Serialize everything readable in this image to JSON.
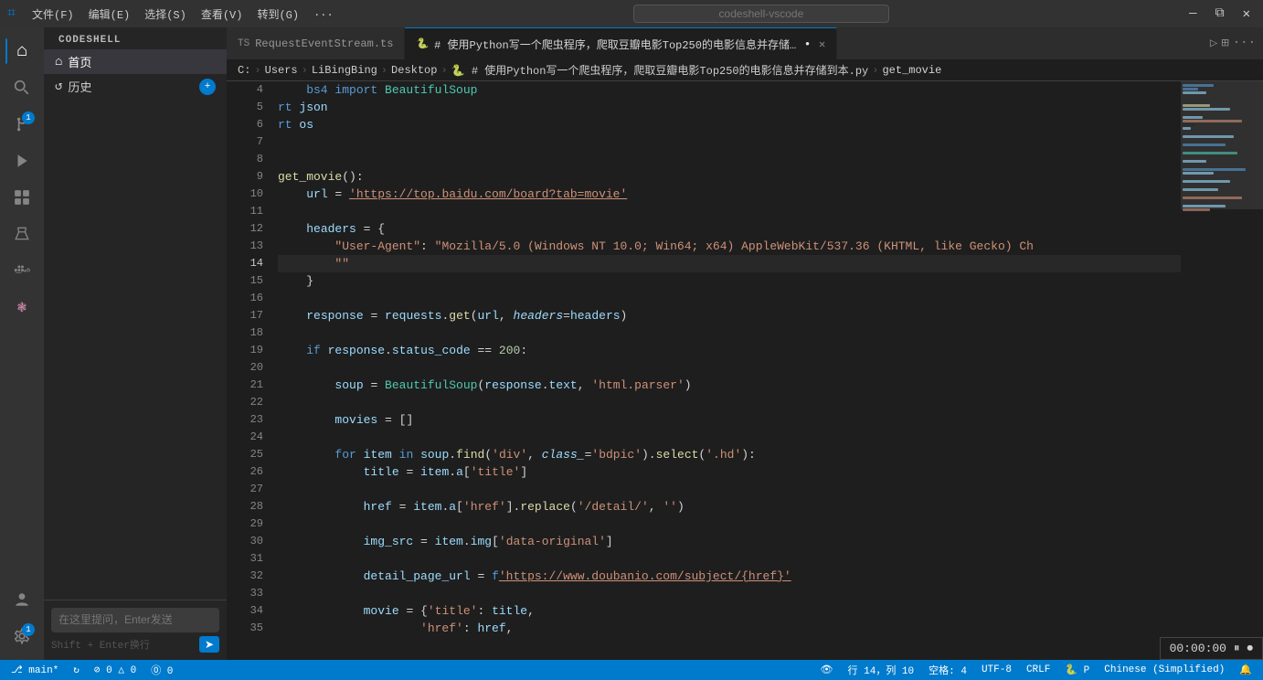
{
  "app": {
    "name": "CODESHELL",
    "title": "codeshell-vscode"
  },
  "titlebar": {
    "menu_items": [
      "文件(F)",
      "编辑(E)",
      "选择(S)",
      "查看(V)",
      "转到(G)",
      "..."
    ],
    "search_placeholder": "codeshell-vscode",
    "win_controls": [
      "—",
      "□",
      "✕"
    ]
  },
  "activitybar": {
    "icons": [
      {
        "id": "home",
        "symbol": "⌂",
        "label": "首页",
        "active": true,
        "badge": null
      },
      {
        "id": "search",
        "symbol": "🔍",
        "label": "搜索",
        "active": false,
        "badge": null
      },
      {
        "id": "git",
        "symbol": "⑂",
        "label": "源代码管理",
        "active": false,
        "badge": "1"
      },
      {
        "id": "debug",
        "symbol": "▷",
        "label": "运行和调试",
        "active": false,
        "badge": null
      },
      {
        "id": "extensions",
        "symbol": "⊞",
        "label": "扩展",
        "active": false,
        "badge": null
      },
      {
        "id": "flask",
        "symbol": "⚗",
        "label": "测试",
        "active": false,
        "badge": null
      },
      {
        "id": "docker",
        "symbol": "🐳",
        "label": "Docker",
        "active": false,
        "badge": null
      },
      {
        "id": "lotus",
        "symbol": "❃",
        "label": "CodeShell",
        "active": false,
        "badge": null
      }
    ],
    "bottom_icons": [
      {
        "id": "account",
        "symbol": "👤",
        "label": "账户",
        "badge": null
      },
      {
        "id": "settings",
        "symbol": "⚙",
        "label": "设置",
        "badge": "1"
      }
    ]
  },
  "sidebar": {
    "header": "CODESHELL",
    "items": [
      {
        "id": "home",
        "icon": "⌂",
        "label": "首页",
        "active": true
      },
      {
        "id": "history",
        "icon": "↺",
        "label": "历史",
        "active": false
      }
    ],
    "new_button": "+",
    "chat_placeholder": "在这里提问，Enter发送",
    "chat_hint": "Shift + Enter换行",
    "chat_send": "➤"
  },
  "tabs": [
    {
      "id": "ts-tab",
      "lang": "TS",
      "name": "RequestEventStream.ts",
      "active": false,
      "modified": false
    },
    {
      "id": "py-tab",
      "lang": "🐍",
      "name": "# 使用Python写一个爬虫程序，爬取豆瓣电影Top250的电影信息并存储到本.py",
      "active": true,
      "modified": true
    }
  ],
  "breadcrumb": [
    "C:",
    "Users",
    "LiBingBing",
    "Desktop",
    "🐍 # 使用Python写一个爬虫程序，爬取豆瓣电影Top250的电影信息并存储到本.py",
    "get_movie"
  ],
  "code": {
    "lines": [
      {
        "num": 4,
        "content": "    bs4 import BeautifulSoup",
        "tokens": [
          {
            "t": "kw",
            "v": "    bs4 import "
          },
          {
            "t": "cls",
            "v": "BeautifulSoup"
          }
        ]
      },
      {
        "num": 5,
        "content": "rt json",
        "tokens": [
          {
            "t": "kw",
            "v": "rt "
          },
          {
            "t": "var",
            "v": "json"
          }
        ]
      },
      {
        "num": 6,
        "content": "rt os",
        "tokens": [
          {
            "t": "kw",
            "v": "rt "
          },
          {
            "t": "var",
            "v": "os"
          }
        ]
      },
      {
        "num": 7,
        "content": "",
        "tokens": []
      },
      {
        "num": 8,
        "content": "",
        "tokens": []
      },
      {
        "num": 9,
        "content": "get_movie():",
        "tokens": [
          {
            "t": "fn",
            "v": "get_movie"
          },
          {
            "t": "punct",
            "v": "():"
          }
        ]
      },
      {
        "num": 10,
        "content": "    url = 'https://top.baidu.com/board?tab=movie'",
        "tokens": [
          {
            "t": "indent",
            "v": "    "
          },
          {
            "t": "var",
            "v": "url"
          },
          {
            "t": "op",
            "v": " = "
          },
          {
            "t": "str-link",
            "v": "'https://top.baidu.com/board?tab=movie'"
          }
        ]
      },
      {
        "num": 11,
        "content": "",
        "tokens": []
      },
      {
        "num": 12,
        "content": "    headers = {",
        "tokens": [
          {
            "t": "indent",
            "v": "    "
          },
          {
            "t": "var",
            "v": "headers"
          },
          {
            "t": "op",
            "v": " = {"
          }
        ]
      },
      {
        "num": 13,
        "content": "        \"User-Agent\": \"Mozilla/5.0 (Windows NT 10.0; Win64; x64) AppleWebKit/537.36 (KHTML, like Gecko) Ch",
        "tokens": [
          {
            "t": "indent",
            "v": "        "
          },
          {
            "t": "str",
            "v": "\"User-Agent\""
          },
          {
            "t": "op",
            "v": ": "
          },
          {
            "t": "str",
            "v": "\"Mozilla/5.0 (Windows NT 10.0; Win64; x64) AppleWebKit/537.36 (KHTML, like Gecko) Ch"
          }
        ]
      },
      {
        "num": 14,
        "content": "        \"\"",
        "tokens": [
          {
            "t": "indent",
            "v": "        "
          },
          {
            "t": "str",
            "v": "\"\""
          }
        ],
        "current": true
      },
      {
        "num": 15,
        "content": "    }",
        "tokens": [
          {
            "t": "indent",
            "v": "    "
          },
          {
            "t": "op",
            "v": "}"
          }
        ]
      },
      {
        "num": 16,
        "content": "",
        "tokens": []
      },
      {
        "num": 17,
        "content": "    response = requests.get(url, headers=headers)",
        "tokens": [
          {
            "t": "indent",
            "v": "    "
          },
          {
            "t": "var",
            "v": "response"
          },
          {
            "t": "op",
            "v": " = "
          },
          {
            "t": "var",
            "v": "requests"
          },
          {
            "t": "op",
            "v": "."
          },
          {
            "t": "fn",
            "v": "get"
          },
          {
            "t": "op",
            "v": "("
          },
          {
            "t": "var",
            "v": "url"
          },
          {
            "t": "op",
            "v": ", "
          },
          {
            "t": "param",
            "v": "headers"
          },
          {
            "t": "op",
            "v": "="
          },
          {
            "t": "var",
            "v": "headers"
          },
          {
            "t": "op",
            "v": ")"
          }
        ]
      },
      {
        "num": 18,
        "content": "",
        "tokens": []
      },
      {
        "num": 19,
        "content": "    if response.status_code == 200:",
        "tokens": [
          {
            "t": "indent",
            "v": "    "
          },
          {
            "t": "kw",
            "v": "if "
          },
          {
            "t": "var",
            "v": "response"
          },
          {
            "t": "op",
            "v": "."
          },
          {
            "t": "var",
            "v": "status_code"
          },
          {
            "t": "op",
            "v": " == "
          },
          {
            "t": "num",
            "v": "200"
          },
          {
            "t": "op",
            "v": ":"
          }
        ]
      },
      {
        "num": 20,
        "content": "",
        "tokens": []
      },
      {
        "num": 21,
        "content": "        soup = BeautifulSoup(response.text, 'html.parser')",
        "tokens": [
          {
            "t": "indent",
            "v": "        "
          },
          {
            "t": "var",
            "v": "soup"
          },
          {
            "t": "op",
            "v": " = "
          },
          {
            "t": "cls",
            "v": "BeautifulSoup"
          },
          {
            "t": "op",
            "v": "("
          },
          {
            "t": "var",
            "v": "response"
          },
          {
            "t": "op",
            "v": "."
          },
          {
            "t": "var",
            "v": "text"
          },
          {
            "t": "op",
            "v": ", "
          },
          {
            "t": "str",
            "v": "'html.parser'"
          },
          {
            "t": "op",
            "v": ")"
          }
        ]
      },
      {
        "num": 22,
        "content": "",
        "tokens": []
      },
      {
        "num": 23,
        "content": "        movies = []",
        "tokens": [
          {
            "t": "indent",
            "v": "        "
          },
          {
            "t": "var",
            "v": "movies"
          },
          {
            "t": "op",
            "v": " = []"
          }
        ]
      },
      {
        "num": 24,
        "content": "",
        "tokens": []
      },
      {
        "num": 25,
        "content": "        for item in soup.find('div', class_='bdpic').select('.hd'):",
        "tokens": [
          {
            "t": "indent",
            "v": "        "
          },
          {
            "t": "kw",
            "v": "for "
          },
          {
            "t": "var",
            "v": "item"
          },
          {
            "t": "kw",
            "v": " in "
          },
          {
            "t": "var",
            "v": "soup"
          },
          {
            "t": "op",
            "v": "."
          },
          {
            "t": "fn",
            "v": "find"
          },
          {
            "t": "op",
            "v": "("
          },
          {
            "t": "str",
            "v": "'div'"
          },
          {
            "t": "op",
            "v": ", "
          },
          {
            "t": "param",
            "v": "class_"
          },
          {
            "t": "op",
            "v": "="
          },
          {
            "t": "str",
            "v": "'bdpic'"
          },
          {
            "t": "op",
            "v": ")."
          },
          {
            "t": "fn",
            "v": "select"
          },
          {
            "t": "op",
            "v": "("
          },
          {
            "t": "str",
            "v": "'.hd'"
          },
          {
            "t": "op",
            "v": "):"
          }
        ]
      },
      {
        "num": 26,
        "content": "            title = item.a['title']",
        "tokens": [
          {
            "t": "indent",
            "v": "            "
          },
          {
            "t": "var",
            "v": "title"
          },
          {
            "t": "op",
            "v": " = "
          },
          {
            "t": "var",
            "v": "item"
          },
          {
            "t": "op",
            "v": "."
          },
          {
            "t": "var",
            "v": "a"
          },
          {
            "t": "op",
            "v": "["
          },
          {
            "t": "str",
            "v": "'title'"
          },
          {
            "t": "op",
            "v": "]"
          }
        ]
      },
      {
        "num": 27,
        "content": "",
        "tokens": []
      },
      {
        "num": 28,
        "content": "            href = item.a['href'].replace('/detail/', '')",
        "tokens": [
          {
            "t": "indent",
            "v": "            "
          },
          {
            "t": "var",
            "v": "href"
          },
          {
            "t": "op",
            "v": " = "
          },
          {
            "t": "var",
            "v": "item"
          },
          {
            "t": "op",
            "v": "."
          },
          {
            "t": "var",
            "v": "a"
          },
          {
            "t": "op",
            "v": "["
          },
          {
            "t": "str",
            "v": "'href'"
          },
          {
            "t": "op",
            "v": "]."
          },
          {
            "t": "fn",
            "v": "replace"
          },
          {
            "t": "op",
            "v": "("
          },
          {
            "t": "str",
            "v": "'/detail/'"
          },
          {
            "t": "op",
            "v": ", "
          },
          {
            "t": "str",
            "v": "''"
          },
          {
            "t": "op",
            "v": ")"
          }
        ]
      },
      {
        "num": 29,
        "content": "",
        "tokens": []
      },
      {
        "num": 30,
        "content": "            img_src = item.img['data-original']",
        "tokens": [
          {
            "t": "indent",
            "v": "            "
          },
          {
            "t": "var",
            "v": "img_src"
          },
          {
            "t": "op",
            "v": " = "
          },
          {
            "t": "var",
            "v": "item"
          },
          {
            "t": "op",
            "v": "."
          },
          {
            "t": "var",
            "v": "img"
          },
          {
            "t": "op",
            "v": "["
          },
          {
            "t": "str",
            "v": "'data-original'"
          },
          {
            "t": "op",
            "v": "]"
          }
        ]
      },
      {
        "num": 31,
        "content": "",
        "tokens": []
      },
      {
        "num": 32,
        "content": "            detail_page_url = f'https://www.doubanio.com/subject/{href}'",
        "tokens": [
          {
            "t": "indent",
            "v": "            "
          },
          {
            "t": "var",
            "v": "detail_page_url"
          },
          {
            "t": "op",
            "v": " = "
          },
          {
            "t": "kw",
            "v": "f"
          },
          {
            "t": "str-link",
            "v": "'https://www.doubanio.com/subject/{href}'"
          }
        ]
      },
      {
        "num": 33,
        "content": "",
        "tokens": []
      },
      {
        "num": 34,
        "content": "            movie = {'title': title,",
        "tokens": [
          {
            "t": "indent",
            "v": "            "
          },
          {
            "t": "var",
            "v": "movie"
          },
          {
            "t": "op",
            "v": " = {"
          },
          {
            "t": "str",
            "v": "'title'"
          },
          {
            "t": "op",
            "v": ": "
          },
          {
            "t": "var",
            "v": "title"
          },
          {
            "t": "op",
            "v": ","
          }
        ]
      },
      {
        "num": 35,
        "content": "                    'href': href,",
        "tokens": [
          {
            "t": "indent",
            "v": "                    "
          },
          {
            "t": "str",
            "v": "'href'"
          },
          {
            "t": "op",
            "v": ": "
          },
          {
            "t": "var",
            "v": "href"
          },
          {
            "t": "op",
            "v": ","
          }
        ]
      }
    ]
  },
  "statusbar": {
    "left": [
      {
        "id": "branch",
        "text": "⎇ main*"
      },
      {
        "id": "sync",
        "text": "↻"
      },
      {
        "id": "errors",
        "text": "⊘ 0  △ 0"
      },
      {
        "id": "info",
        "text": "⓪ 0"
      }
    ],
    "right": [
      {
        "id": "visibility",
        "text": "👁"
      },
      {
        "id": "line-col",
        "text": "行 14，列 10"
      },
      {
        "id": "spaces",
        "text": "空格: 4"
      },
      {
        "id": "encoding",
        "text": "UTF-8"
      },
      {
        "id": "eol",
        "text": "CRLF"
      },
      {
        "id": "lang",
        "text": "🐍 P"
      },
      {
        "id": "chinese",
        "text": "Chinese (Simplified)"
      },
      {
        "id": "bell",
        "text": "🔔"
      }
    ]
  },
  "timer": {
    "time": "00:00:00",
    "pause": "⏸",
    "record": "⏺"
  }
}
